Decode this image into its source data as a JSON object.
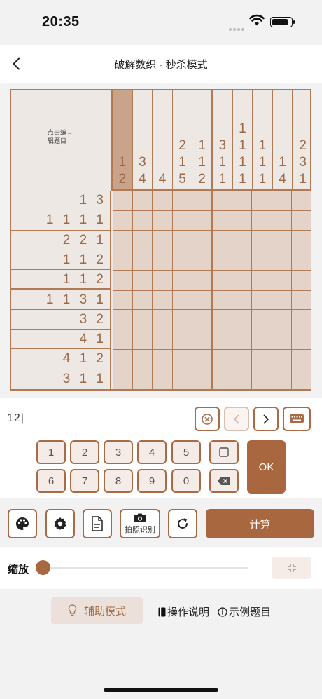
{
  "status": {
    "time": "20:35"
  },
  "nav": {
    "title": "破解数织 - 秒杀模式"
  },
  "board": {
    "corner_hint_line1": "点击编",
    "corner_hint_line2": "辑题目",
    "arrow_right": "→",
    "arrow_down": "↓",
    "selected_column": 0,
    "columns": [
      [
        "1",
        "2"
      ],
      [
        "3",
        "4"
      ],
      [
        "4"
      ],
      [
        "2",
        "1",
        "5"
      ],
      [
        "1",
        "1",
        "2"
      ],
      [
        "3",
        "1",
        "1"
      ],
      [
        "1",
        "1",
        "1",
        "1"
      ],
      [
        "1",
        "1",
        "1"
      ],
      [
        "1",
        "4"
      ],
      [
        "2",
        "3",
        "1"
      ]
    ],
    "rows": [
      "1 3",
      "1 1 1 1",
      "2 2 1",
      "1 1 2",
      "1 1 2",
      "1 1 3 1",
      "3 2",
      "4 1",
      "4 1 2",
      "3 1 1"
    ]
  },
  "input": {
    "value": "12|",
    "keys": [
      "1",
      "2",
      "3",
      "4",
      "5",
      "6",
      "7",
      "8",
      "9",
      "0"
    ],
    "ok_label": "OK"
  },
  "toolbar": {
    "photo_label": "拍照识别",
    "calc_label": "计算"
  },
  "zoom": {
    "label": "缩放",
    "value": 0
  },
  "bottom": {
    "assist_label": "辅助模式",
    "instructions_label": "操作说明",
    "example_label": "示例题目"
  }
}
